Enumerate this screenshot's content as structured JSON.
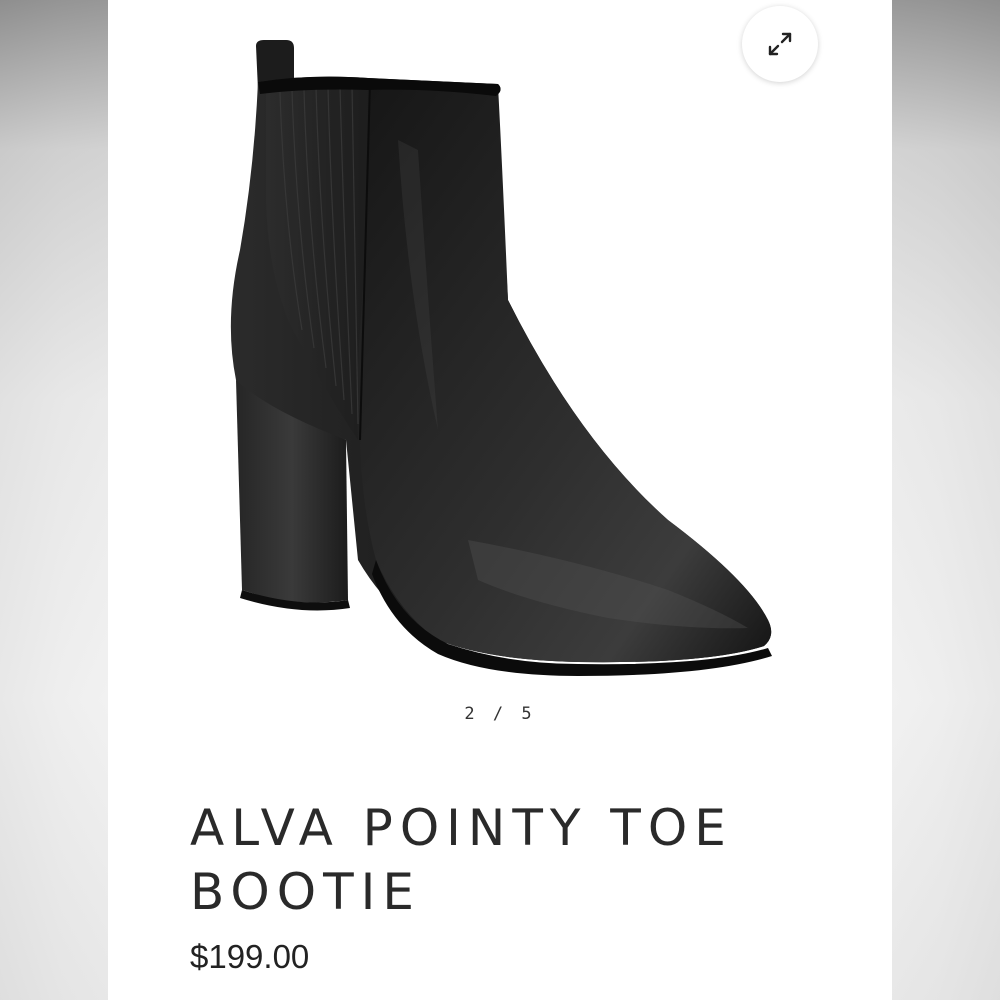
{
  "gallery": {
    "current": "2",
    "separator": "/",
    "total": "5",
    "expand_icon": "expand-arrows-icon",
    "image_subject": "black leather pointy toe ankle bootie"
  },
  "product": {
    "title_line1": "ALVA POINTY TOE",
    "title_line2": "BOOTIE",
    "price": "$199.00"
  },
  "colors": {
    "background": "#ffffff",
    "text": "#2a2a2a",
    "boot": "#1a1a1a"
  }
}
